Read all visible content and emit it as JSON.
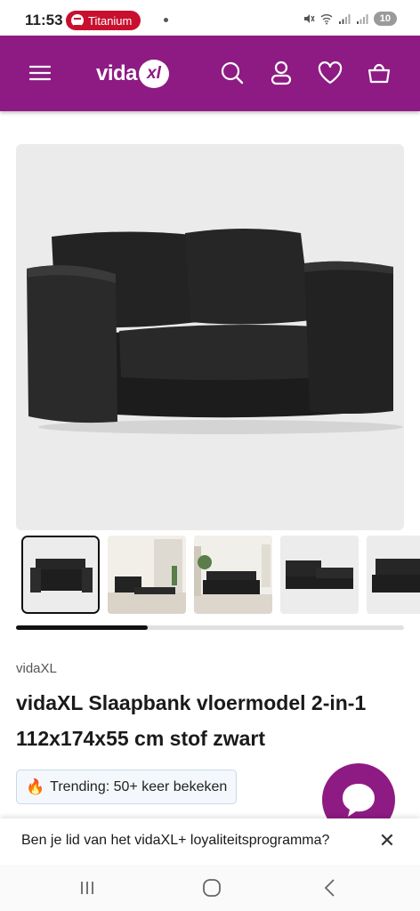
{
  "status_bar": {
    "time": "11:53",
    "media_app": "Titanium",
    "battery_level": "10",
    "icons": [
      "spotify-icon",
      "mute-icon",
      "wifi-icon",
      "signal-icon",
      "signal-icon"
    ]
  },
  "header": {
    "logo_text": "vida",
    "logo_badge": "xl",
    "icons": [
      "menu-icon",
      "search-icon",
      "account-icon",
      "heart-icon",
      "basket-icon"
    ],
    "background_color": "#8e1b83"
  },
  "product": {
    "brand": "vidaXL",
    "title": "vidaXL Slaapbank vloermodel 2-in-1 112x174x55 cm stof zwart",
    "image_count_visible": 5,
    "gallery_scroll_progress": 0.34
  },
  "trending": {
    "icon": "fire-icon",
    "label": "Trending: 50+ keer bekeken"
  },
  "loyalty_banner": {
    "message": "Ben je lid van het vidaXL+ loyaliteitsprogramma?",
    "close_icon": "close-icon"
  },
  "chat": {
    "icon": "chat-icon",
    "color": "#8e1b83"
  },
  "system_nav": {
    "buttons": [
      "recent-apps-icon",
      "home-icon",
      "back-icon"
    ]
  }
}
